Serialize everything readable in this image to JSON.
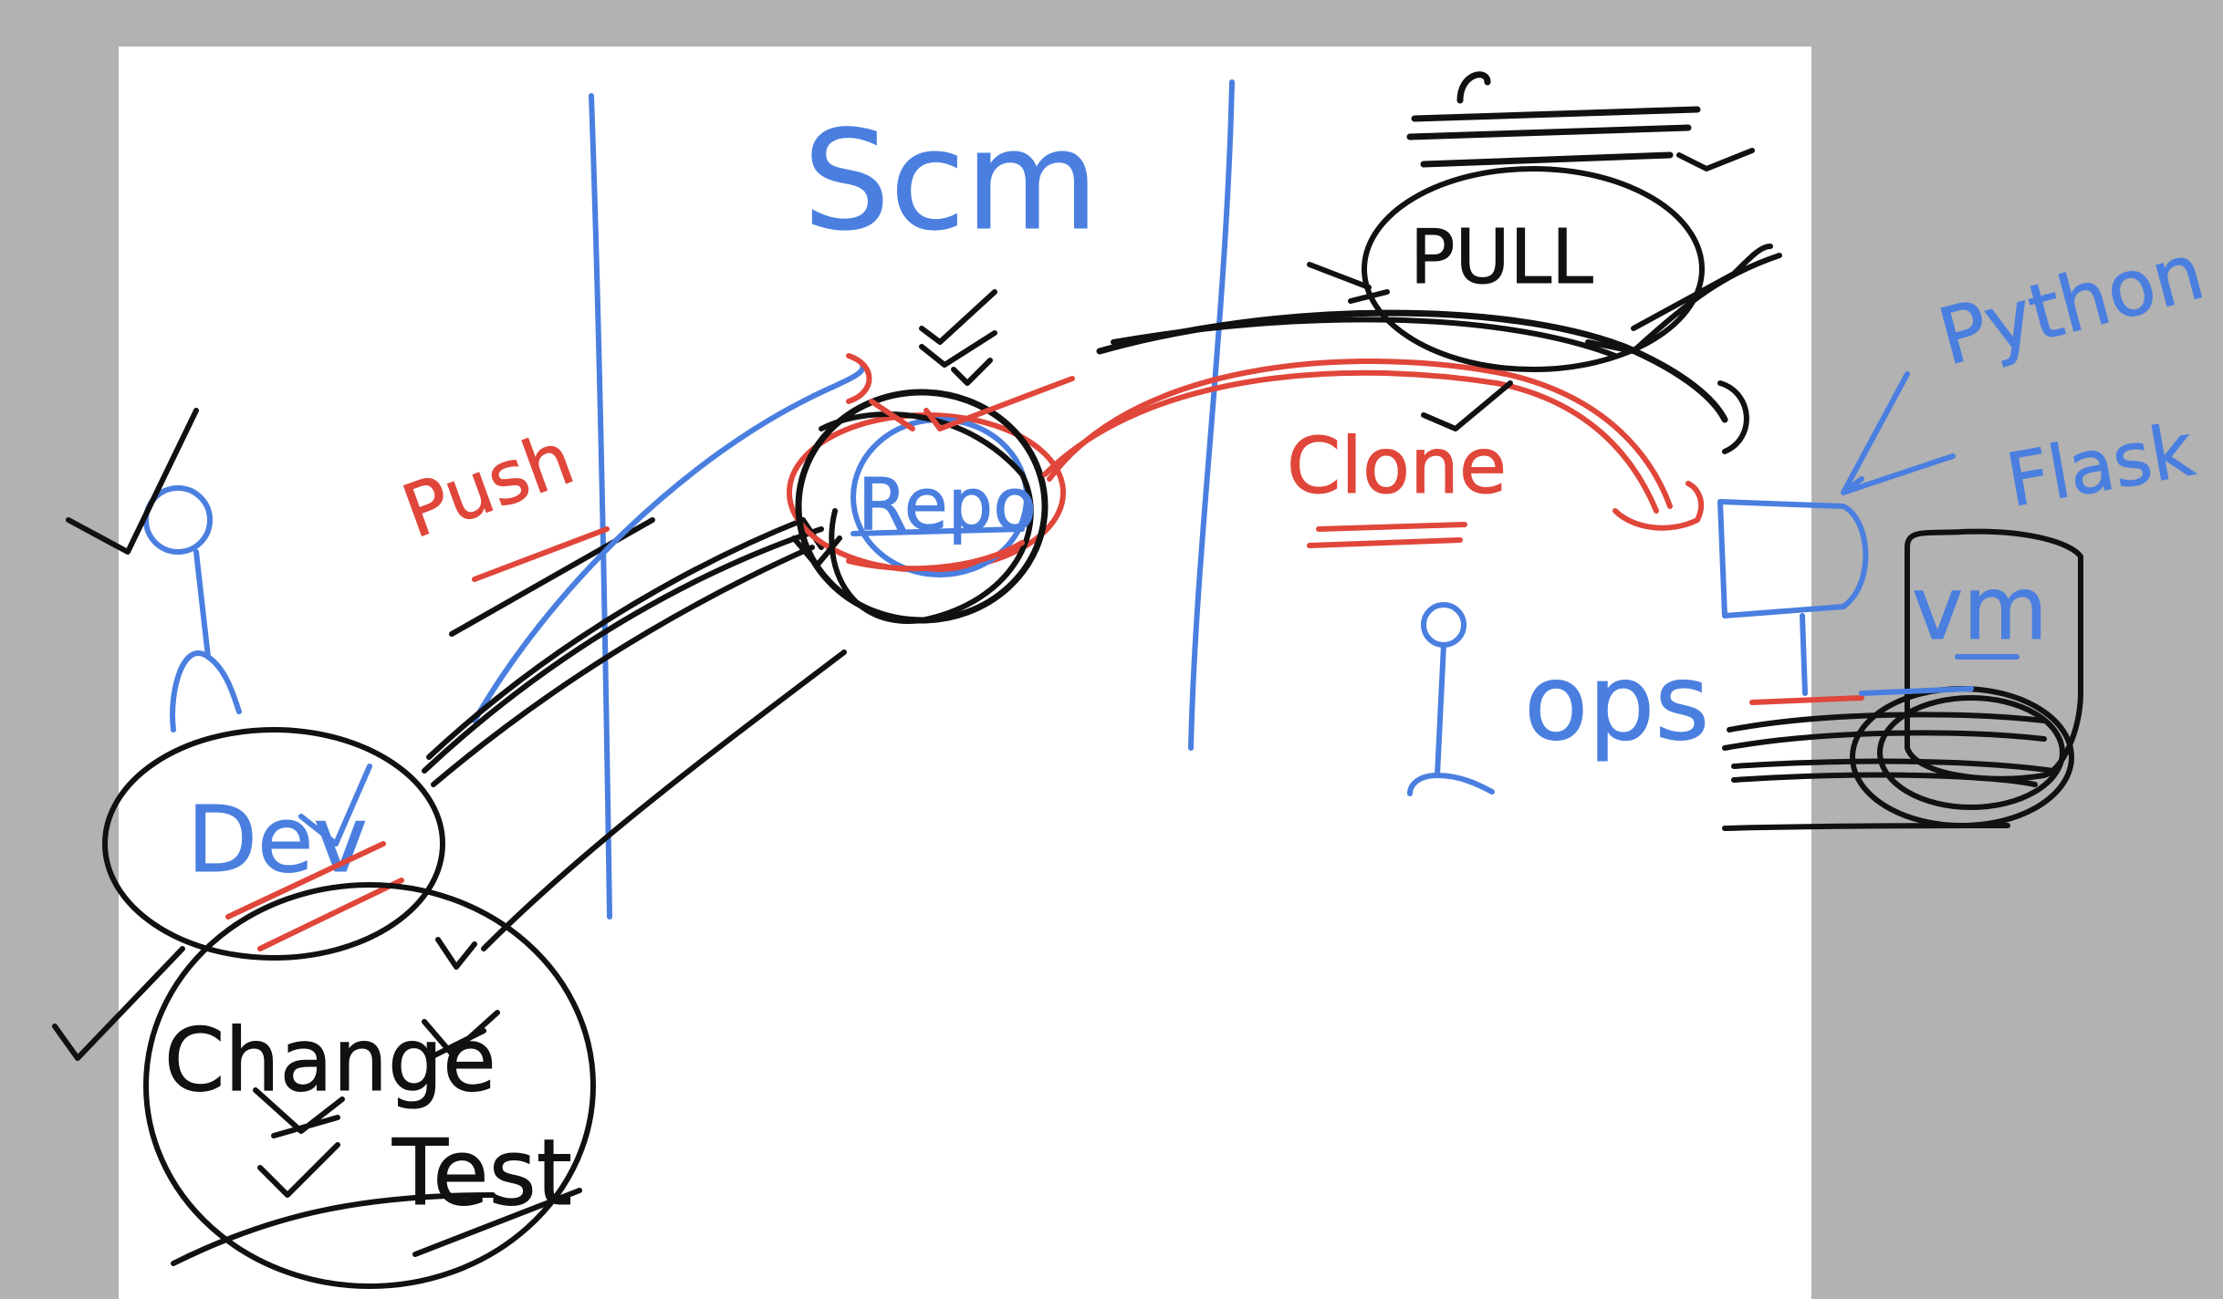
{
  "colors": {
    "blue_ink": "#4a7fe0",
    "red_ink": "#e0463a",
    "black_ink": "#111111",
    "paper": "#ffffff",
    "backdrop": "#b2b2b2"
  },
  "labels": {
    "scm": "Scm",
    "push": "Push",
    "repo": "Repo",
    "pull": "PULL",
    "clone": "Clone",
    "dev": "Dev",
    "ops": "ops",
    "change": "Change",
    "test": "Test",
    "python": "Python",
    "flask": "Flask",
    "vm": "vm"
  }
}
